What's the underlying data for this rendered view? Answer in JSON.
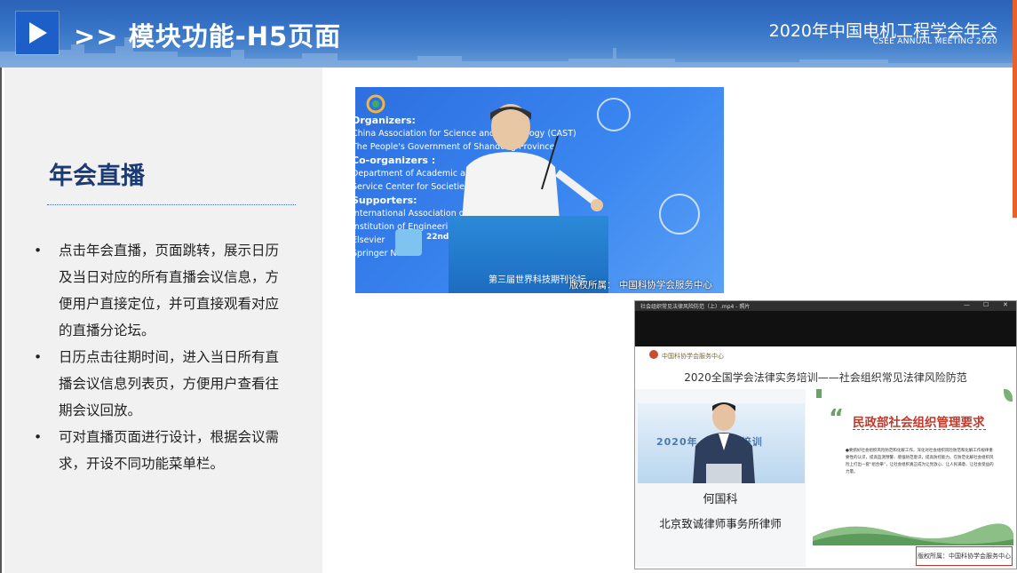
{
  "header": {
    "title": ">> 模块功能-H5页面",
    "meeting_cn": "2020年中国电机工程学会年会",
    "meeting_en": "CSEE ANNUAL MEETING 2020",
    "play_icon": "play-icon"
  },
  "section": {
    "title": "年会直播",
    "bullet_symbol": "•",
    "bullets": [
      "点击年会直播，页面跳转，展示日历及当日对应的所有直播会议信息，方便用户直接定位，并可直接观看对应的直播分论坛。",
      "日历点击往期时间，进入当日所有直播会议信息列表页，方便用户查看往期会议回放。",
      "可对直播页面进行设计，根据会议需求，开设不同功能菜单栏。"
    ]
  },
  "video1": {
    "lines": [
      {
        "text": "Organizers:",
        "bold": true
      },
      {
        "text": "China Association for Science and Technology (CAST)",
        "bold": false
      },
      {
        "text": "The People's Government of Shandong Province",
        "bold": false
      },
      {
        "text": "Co-organizers :",
        "bold": true
      },
      {
        "text": "Department of Academic and ... CAST",
        "bold": false
      },
      {
        "text": "Service Center for Societies ...",
        "bold": false
      },
      {
        "text": "Supporters:",
        "bold": true
      },
      {
        "text": "International Association of ... Publishers",
        "bold": false
      },
      {
        "text": "Institution of Engineering",
        "bold": false
      },
      {
        "text": "Elsevier",
        "bold": false
      },
      {
        "text": "Springer Nature",
        "bold": false
      }
    ],
    "podium_number": "22nd",
    "podium_text": "第三届世界科技期刊论坛",
    "copyright": "版权所属：  中国科协学会服务中心"
  },
  "video2": {
    "window_title": "社会组织常见法律风险防范（上）.mp4 - 照片",
    "controls": [
      "—",
      "☐",
      "✕"
    ],
    "org_logo": "中国科协学会服务中心",
    "title": "2020全国学会法律实务培训——社会组织常见法律风险防范",
    "speaker_banner": "2020年 ... 实务培训",
    "speaker_name": "何国科",
    "speaker_firm": "北京致诚律师事务所律师",
    "slide_quote": "“",
    "slide_title": "民政部社会组织管理要求",
    "slide_body": "●要抓好社会组织风险防范和化解工作，深化对社会组织风险防范和化解工作规律重要性的认识，提高监测预警、增强防范意识，提高防控能力。在防范化解社会组织风险上打出一套“组合拳”，让社会组织真正成为让党放心、让人民满意、让社会受益的力量。",
    "copyright": "版权所属：中国科协学会服务中心"
  }
}
